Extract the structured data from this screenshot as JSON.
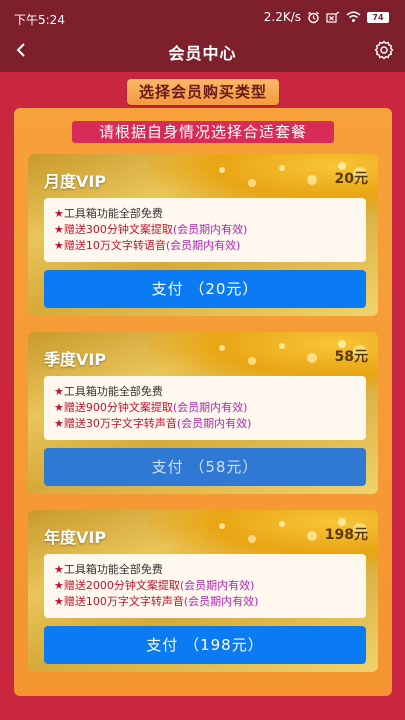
{
  "status": {
    "time": "下午5:24",
    "speed": "2.2K/s",
    "battery": "74"
  },
  "header": {
    "title": "会员中心"
  },
  "type_badge": "选择会员购买类型",
  "hint": "请根据自身情况选择合适套餐",
  "plans": [
    {
      "name": "月度VIP",
      "price": "20元",
      "features": [
        {
          "star": "★",
          "text": "工具箱功能全部免费",
          "suffix": ""
        },
        {
          "star": "★",
          "text": "赠送300分钟文案提取",
          "suffix": "(会员期内有效)"
        },
        {
          "star": "★",
          "text": "赠送10万文字转语音",
          "suffix": "(会员期内有效)"
        }
      ],
      "pay_label": "支付 （20元）"
    },
    {
      "name": "季度VIP",
      "price": "58元",
      "features": [
        {
          "star": "★",
          "text": "工具箱功能全部免费",
          "suffix": ""
        },
        {
          "star": "★",
          "text": "赠送900分钟文案提取",
          "suffix": "(会员期内有效)"
        },
        {
          "star": "★",
          "text": "赠送30万字文字转声音",
          "suffix": "(会员期内有效)"
        }
      ],
      "pay_label": "支付 （58元）"
    },
    {
      "name": "年度VIP",
      "price": "198元",
      "features": [
        {
          "star": "★",
          "text": "工具箱功能全部免费",
          "suffix": ""
        },
        {
          "star": "★",
          "text": "赠送2000分钟文案提取",
          "suffix": "(会员期内有效)"
        },
        {
          "star": "★",
          "text": "赠送100万字文字转声音",
          "suffix": "(会员期内有效)"
        }
      ],
      "pay_label": "支付 （198元）"
    }
  ],
  "colors": {
    "background": "#c8273f",
    "header": "#7e1f2c",
    "panel": "#f7a13b",
    "pay_button": "#0a7bf3",
    "highlight": "#c0132b",
    "suffix": "#b025b8"
  },
  "icons": {
    "back": "back-arrow-icon",
    "settings": "gear-icon",
    "alarm": "alarm-icon",
    "wifi": "wifi-icon",
    "battery": "battery-icon"
  }
}
